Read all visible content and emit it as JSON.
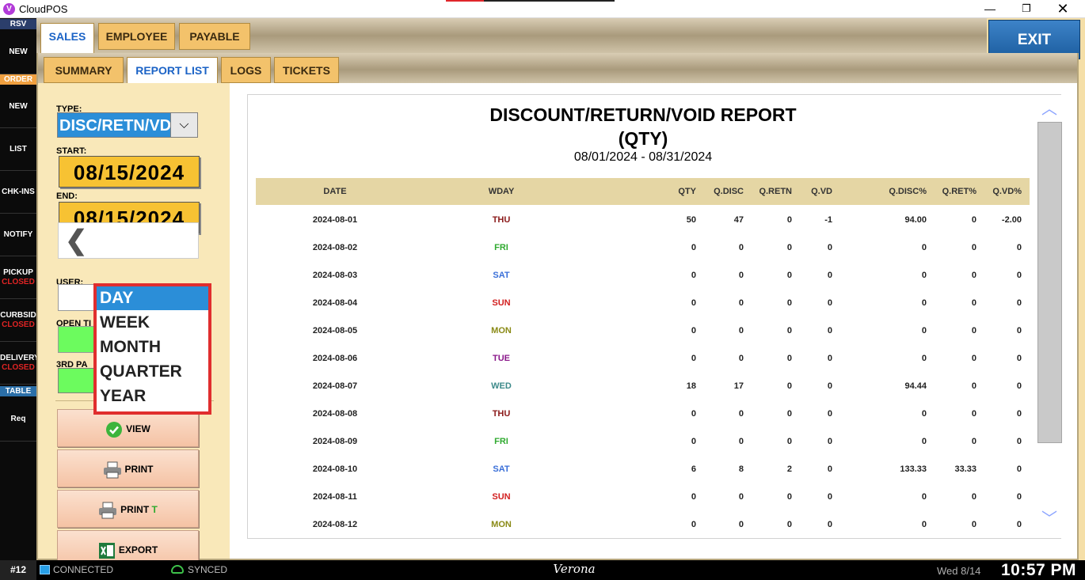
{
  "window": {
    "title": "CloudPOS",
    "logo_letter": "V",
    "min": "—",
    "max": "❐",
    "close": "✕"
  },
  "sidebar": {
    "rsv_header": "RSV",
    "order_header": "ORDER",
    "table_header": "TABLE",
    "items": [
      {
        "label": "NEW",
        "status": ""
      },
      {
        "label": "NEW",
        "status": ""
      },
      {
        "label": "LIST",
        "status": ""
      },
      {
        "label": "CHK-INS",
        "status": ""
      },
      {
        "label": "NOTIFY",
        "status": ""
      },
      {
        "label": "PICKUP",
        "status": "CLOSED"
      },
      {
        "label": "CURBSID",
        "status": "CLOSED"
      },
      {
        "label": "DELIVERY",
        "status": "CLOSED"
      },
      {
        "label": "Req",
        "status": ""
      }
    ]
  },
  "top_tabs": [
    "SALES",
    "EMPLOYEE",
    "PAYABLE"
  ],
  "exit_label": "EXIT",
  "sub_tabs": [
    "SUMMARY",
    "REPORT LIST",
    "LOGS",
    "TICKETS"
  ],
  "filters": {
    "type_label": "TYPE:",
    "type_value": "DISC/RETN/VD",
    "start_label": "START:",
    "start_value": "08/15/2024",
    "end_label": "END:",
    "end_value": "08/15/2024",
    "user_label": "USER:",
    "open_label": "OPEN TI",
    "third_label": "3RD PA",
    "prev_glyph": "❮",
    "dd_glyph": "⌵"
  },
  "period_dropdown": {
    "options": [
      "DAY",
      "WEEK",
      "MONTH",
      "QUARTER",
      "YEAR"
    ],
    "selected": "DAY"
  },
  "actions": {
    "view": "VIEW",
    "print": "PRINT",
    "print_t": "PRINT",
    "print_t_suffix": "T",
    "export": "EXPORT"
  },
  "report": {
    "title": "DISCOUNT/RETURN/VOID REPORT",
    "subtitle": "(QTY)",
    "range": "08/01/2024 - 08/31/2024",
    "columns": [
      "DATE",
      "WDAY",
      "QTY",
      "Q.DISC",
      "Q.RETN",
      "Q.VD",
      "Q.DISC%",
      "Q.RET%",
      "Q.VD%"
    ],
    "rows": [
      [
        "2024-08-01",
        "THU",
        "50",
        "47",
        "0",
        "-1",
        "94.00",
        "0",
        "-2.00"
      ],
      [
        "2024-08-02",
        "FRI",
        "0",
        "0",
        "0",
        "0",
        "0",
        "0",
        "0"
      ],
      [
        "2024-08-03",
        "SAT",
        "0",
        "0",
        "0",
        "0",
        "0",
        "0",
        "0"
      ],
      [
        "2024-08-04",
        "SUN",
        "0",
        "0",
        "0",
        "0",
        "0",
        "0",
        "0"
      ],
      [
        "2024-08-05",
        "MON",
        "0",
        "0",
        "0",
        "0",
        "0",
        "0",
        "0"
      ],
      [
        "2024-08-06",
        "TUE",
        "0",
        "0",
        "0",
        "0",
        "0",
        "0",
        "0"
      ],
      [
        "2024-08-07",
        "WED",
        "18",
        "17",
        "0",
        "0",
        "94.44",
        "0",
        "0"
      ],
      [
        "2024-08-08",
        "THU",
        "0",
        "0",
        "0",
        "0",
        "0",
        "0",
        "0"
      ],
      [
        "2024-08-09",
        "FRI",
        "0",
        "0",
        "0",
        "0",
        "0",
        "0",
        "0"
      ],
      [
        "2024-08-10",
        "SAT",
        "6",
        "8",
        "2",
        "0",
        "133.33",
        "33.33",
        "0"
      ],
      [
        "2024-08-11",
        "SUN",
        "0",
        "0",
        "0",
        "0",
        "0",
        "0",
        "0"
      ],
      [
        "2024-08-12",
        "MON",
        "0",
        "0",
        "0",
        "0",
        "0",
        "0",
        "0"
      ]
    ],
    "wday_colors": {
      "MON": "#8a8a16",
      "TUE": "#8b1a8b",
      "WED": "#3d8a8a",
      "THU": "#8b1a1a",
      "FRI": "#2faa2f",
      "SAT": "#3a6fd8",
      "SUN": "#d21f1f"
    },
    "scroll_up": "︿",
    "scroll_down": "﹀"
  },
  "status": {
    "station": "#12",
    "connection": "CONNECTED",
    "sync": "SYNCED",
    "location": "Verona",
    "date": "Wed 8/14",
    "time": "10:57 PM"
  }
}
